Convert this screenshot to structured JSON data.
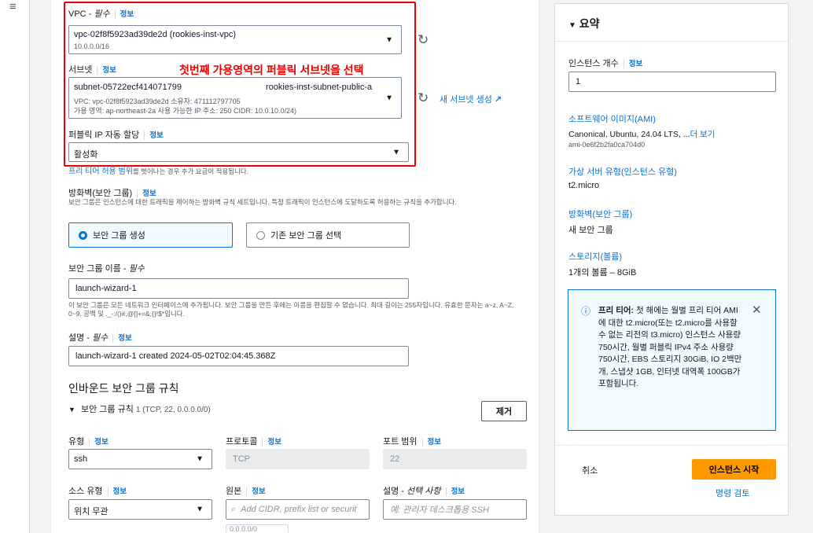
{
  "nav": {
    "menu_icon": "≡"
  },
  "network": {
    "vpc_label": "VPC - ",
    "vpc_required": "필수",
    "info": "정보",
    "vpc_value": "vpc-02f8f5923ad39de2d (rookies-inst-vpc)",
    "vpc_cidr": "10.0.0.0/16",
    "subnet_label": "서브넷",
    "annotation": "첫번째 가용영역의 퍼블릭 서브넷을 선택",
    "subnet_id": "subnet-05722ecf414071799",
    "subnet_name": "rookies-inst-subnet-public-a",
    "subnet_meta1": "VPC: vpc-02f8f5923ad39de2d   소유자: 471112797705",
    "subnet_meta2": "가용 영역: ap-northeast-2a    사용 가능한 IP 주소: 250    CIDR: 10.0.10.0/24)",
    "new_subnet": "새 서브넷 생성",
    "public_ip_label": "퍼블릭 IP 자동 할당",
    "public_ip_value": "활성화",
    "free_tier_note_link": "프리 티어 허용 범위",
    "free_tier_note_rest": "를 벗어나는 경우 추가 요금이 적용됩니다."
  },
  "firewall": {
    "label": "방화벽(보안 그룹)",
    "desc": "보안 그룹은 인스턴스에 대한 트래픽을 제어하는 방화벽 규칙 세트입니다. 특정 트래픽이 인스턴스에 도달하도록 허용하는 규칙을 추가합니다.",
    "opt_create": "보안 그룹 생성",
    "opt_existing": "기존 보안 그룹 선택",
    "sg_name_label": "보안 그룹 이름 - ",
    "required": "필수",
    "sg_name_value": "launch-wizard-1",
    "sg_name_desc": "이 보안 그룹은 모든 네트워크 인터페이스에 추가됩니다. 보안 그룹을 만든 후에는 이름을 편집할 수 없습니다. 최대 길이는 255자입니다. 유효한 문자는 a~z, A~Z, 0~9, 공백 및 ._-:/()#,@[]+=&;{}!$*입니다.",
    "desc_label": "설명 - ",
    "desc_value": "launch-wizard-1 created 2024-05-02T02:04:45.368Z",
    "inbound_title": "인바운드 보안 그룹 규칙",
    "rule_title": "보안 그룹 규칙",
    "rule_sub": "1 (TCP, 22, 0.0.0.0/0)",
    "remove_btn": "제거",
    "type_label": "유형",
    "type_value": "ssh",
    "protocol_label": "프로토콜",
    "protocol_value": "TCP",
    "port_label": "포트 범위",
    "port_value": "22",
    "source_type_label": "소스 유형",
    "source_type_value": "위치 무관",
    "source_label": "원본",
    "source_placeholder": "Add CIDR, prefix list or securit",
    "rule_desc_label": "설명 - ",
    "rule_desc_optional": "선택 사항",
    "rule_desc_placeholder": "예: 관리자 데스크톱용 SSH",
    "source_chip": "0.0.0.0/0"
  },
  "summary": {
    "title": "요약",
    "count_label": "인스턴스 개수",
    "info": "정보",
    "count_value": "1",
    "ami_label": "소프트웨어 이미지(AMI)",
    "ami_value": "Canonical, Ubuntu, 24.04 LTS, ...",
    "ami_more": "더 보기",
    "ami_id": "ami-0e6f2b2fa0ca704d0",
    "type_label": "가상 서버 유형(인스턴스 유형)",
    "type_value": "t2.micro",
    "fw_label": "방화벽(보안 그룹)",
    "fw_value": "새 보안 그룹",
    "storage_label": "스토리지(볼륨)",
    "storage_value": "1개의 볼륨 – 8GiB",
    "free_title": "프리 티어:",
    "free_text": "첫 해에는 월별 프리 티어 AMI에 대한 t2.micro(또는 t2.micro를 사용할 수 없는 리전의 t3.micro) 인스턴스 사용량 750시간, 월별 퍼블릭 IPv4 주소 사용량 750시간, EBS 스토리지 30GiB, IO 2백만 개, 스냅샷 1GB, 인터넷 대역폭 100GB가 포함됩니다.",
    "cancel": "취소",
    "launch": "인스턴스 시작",
    "review": "명령 검토"
  }
}
